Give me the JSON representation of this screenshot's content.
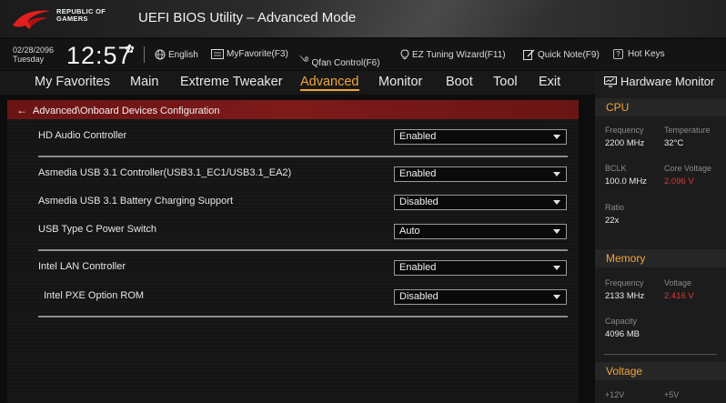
{
  "header": {
    "brand_line1": "REPUBLIC OF",
    "brand_line2": "GAMERS",
    "title": "UEFI BIOS Utility – Advanced Mode"
  },
  "toolbar": {
    "date": "02/28/2096",
    "day": "Tuesday",
    "time": "12:57",
    "items": [
      {
        "label": "English",
        "icon": "globe-icon"
      },
      {
        "label": "MyFavorite(F3)",
        "icon": "favorite-list-icon"
      },
      {
        "label": "Qfan Control(F6)",
        "icon": "fan-icon"
      },
      {
        "label": "EZ Tuning Wizard(F11)",
        "icon": "bulb-icon"
      },
      {
        "label": "Quick Note(F9)",
        "icon": "note-pencil-icon"
      },
      {
        "label": "Hot Keys",
        "icon": "question-box-icon"
      }
    ]
  },
  "menu": {
    "tabs": [
      "My Favorites",
      "Main",
      "Extreme Tweaker",
      "Advanced",
      "Monitor",
      "Boot",
      "Tool",
      "Exit"
    ],
    "active": "Advanced"
  },
  "breadcrumb": "Advanced\\Onboard Devices Configuration",
  "settings": [
    {
      "label": "HD Audio Controller",
      "value": "Enabled"
    },
    {
      "label": "Asmedia USB 3.1 Controller(USB3.1_EC1/USB3.1_EA2)",
      "value": "Enabled"
    },
    {
      "label": "Asmedia USB 3.1 Battery Charging Support",
      "value": "Disabled"
    },
    {
      "label": "USB Type C Power Switch",
      "value": "Auto"
    },
    {
      "label": "Intel LAN Controller",
      "value": "Enabled"
    },
    {
      "label": "Intel PXE Option ROM",
      "value": "Disabled"
    }
  ],
  "hardware_monitor": {
    "title": "Hardware Monitor",
    "cpu": {
      "section": "CPU",
      "frequency_label": "Frequency",
      "frequency": "2200 MHz",
      "temperature_label": "Temperature",
      "temperature": "32°C",
      "bclk_label": "BCLK",
      "bclk": "100.0 MHz",
      "core_voltage_label": "Core Voltage",
      "core_voltage": "2.096 V",
      "ratio_label": "Ratio",
      "ratio": "22x"
    },
    "memory": {
      "section": "Memory",
      "frequency_label": "Frequency",
      "frequency": "2133 MHz",
      "voltage_label": "Voltage",
      "voltage": "2.416 V",
      "capacity_label": "Capacity",
      "capacity": "4096 MB"
    },
    "voltage": {
      "section": "Voltage",
      "v12_label": "+12V",
      "v5_label": "+5V"
    }
  },
  "colors": {
    "accent": "#f2a43a",
    "breadcrumb_bg": "#7e1a1a",
    "warning_value": "#d83a3a"
  }
}
